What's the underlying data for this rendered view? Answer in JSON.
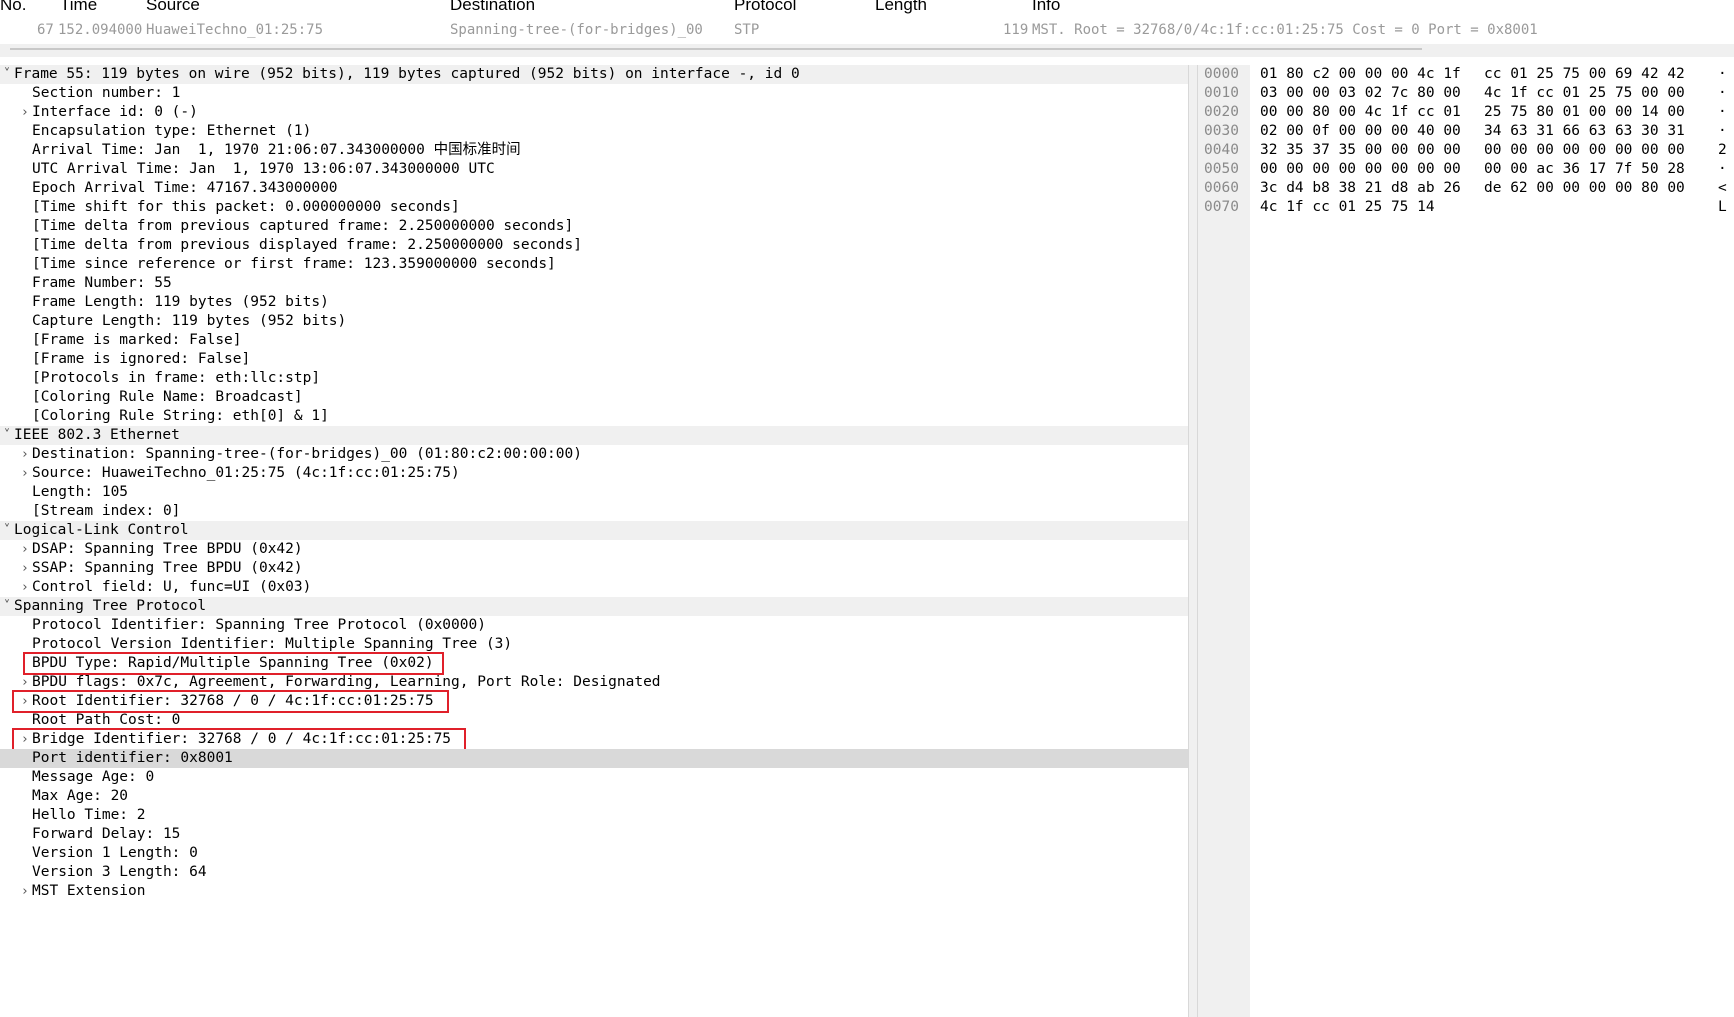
{
  "packet_list": {
    "columns": [
      "No.",
      "Time",
      "Source",
      "Destination",
      "Protocol",
      "Length",
      "Info"
    ],
    "row": {
      "no": "67",
      "time": "152.094000",
      "source": "HuaweiTechno_01:25:75",
      "destination": "Spanning-tree-(for-bridges)_00",
      "protocol": "STP",
      "length": "119",
      "info": "MST. Root = 32768/0/4c:1f:cc:01:25:75  Cost = 0  Port = 0x8001"
    }
  },
  "details": [
    {
      "text": "Frame 55: 119 bytes on wire (952 bits), 119 bytes captured (952 bits) on interface -, id 0",
      "indent": 0,
      "expander": "expanded",
      "section": true
    },
    {
      "text": "Section number: 1",
      "indent": 1,
      "expander": "none"
    },
    {
      "text": "Interface id: 0 (-)",
      "indent": 1,
      "expander": "collapsed"
    },
    {
      "text": "Encapsulation type: Ethernet (1)",
      "indent": 1,
      "expander": "none"
    },
    {
      "text": "Arrival Time: Jan  1, 1970 21:06:07.343000000 中国标准时间",
      "indent": 1,
      "expander": "none"
    },
    {
      "text": "UTC Arrival Time: Jan  1, 1970 13:06:07.343000000 UTC",
      "indent": 1,
      "expander": "none"
    },
    {
      "text": "Epoch Arrival Time: 47167.343000000",
      "indent": 1,
      "expander": "none"
    },
    {
      "text": "[Time shift for this packet: 0.000000000 seconds]",
      "indent": 1,
      "expander": "none"
    },
    {
      "text": "[Time delta from previous captured frame: 2.250000000 seconds]",
      "indent": 1,
      "expander": "none"
    },
    {
      "text": "[Time delta from previous displayed frame: 2.250000000 seconds]",
      "indent": 1,
      "expander": "none"
    },
    {
      "text": "[Time since reference or first frame: 123.359000000 seconds]",
      "indent": 1,
      "expander": "none"
    },
    {
      "text": "Frame Number: 55",
      "indent": 1,
      "expander": "none"
    },
    {
      "text": "Frame Length: 119 bytes (952 bits)",
      "indent": 1,
      "expander": "none"
    },
    {
      "text": "Capture Length: 119 bytes (952 bits)",
      "indent": 1,
      "expander": "none"
    },
    {
      "text": "[Frame is marked: False]",
      "indent": 1,
      "expander": "none"
    },
    {
      "text": "[Frame is ignored: False]",
      "indent": 1,
      "expander": "none"
    },
    {
      "text": "[Protocols in frame: eth:llc:stp]",
      "indent": 1,
      "expander": "none"
    },
    {
      "text": "[Coloring Rule Name: Broadcast]",
      "indent": 1,
      "expander": "none"
    },
    {
      "text": "[Coloring Rule String: eth[0] & 1]",
      "indent": 1,
      "expander": "none"
    },
    {
      "text": "IEEE 802.3 Ethernet",
      "indent": 0,
      "expander": "expanded",
      "section": true
    },
    {
      "text": "Destination: Spanning-tree-(for-bridges)_00 (01:80:c2:00:00:00)",
      "indent": 1,
      "expander": "collapsed"
    },
    {
      "text": "Source: HuaweiTechno_01:25:75 (4c:1f:cc:01:25:75)",
      "indent": 1,
      "expander": "collapsed"
    },
    {
      "text": "Length: 105",
      "indent": 1,
      "expander": "none"
    },
    {
      "text": "[Stream index: 0]",
      "indent": 1,
      "expander": "none"
    },
    {
      "text": "Logical-Link Control",
      "indent": 0,
      "expander": "expanded",
      "section": true
    },
    {
      "text": "DSAP: Spanning Tree BPDU (0x42)",
      "indent": 1,
      "expander": "collapsed"
    },
    {
      "text": "SSAP: Spanning Tree BPDU (0x42)",
      "indent": 1,
      "expander": "collapsed"
    },
    {
      "text": "Control field: U, func=UI (0x03)",
      "indent": 1,
      "expander": "collapsed"
    },
    {
      "text": "Spanning Tree Protocol",
      "indent": 0,
      "expander": "expanded",
      "section": true
    },
    {
      "text": "Protocol Identifier: Spanning Tree Protocol (0x0000)",
      "indent": 1,
      "expander": "none"
    },
    {
      "text": "Protocol Version Identifier: Multiple Spanning Tree (3)",
      "indent": 1,
      "expander": "none"
    },
    {
      "text": "BPDU Type: Rapid/Multiple Spanning Tree (0x02)",
      "indent": 1,
      "expander": "none",
      "boxed": true
    },
    {
      "text": "BPDU flags: 0x7c, Agreement, Forwarding, Learning, Port Role: Designated",
      "indent": 1,
      "expander": "collapsed"
    },
    {
      "text": "Root Identifier: 32768 / 0 / 4c:1f:cc:01:25:75",
      "indent": 1,
      "expander": "collapsed",
      "boxed": true
    },
    {
      "text": "Root Path Cost: 0",
      "indent": 1,
      "expander": "none"
    },
    {
      "text": "Bridge Identifier: 32768 / 0 / 4c:1f:cc:01:25:75",
      "indent": 1,
      "expander": "collapsed",
      "boxed": true
    },
    {
      "text": "Port identifier: 0x8001",
      "indent": 1,
      "expander": "none",
      "selected": true
    },
    {
      "text": "Message Age: 0",
      "indent": 1,
      "expander": "none"
    },
    {
      "text": "Max Age: 20",
      "indent": 1,
      "expander": "none"
    },
    {
      "text": "Hello Time: 2",
      "indent": 1,
      "expander": "none"
    },
    {
      "text": "Forward Delay: 15",
      "indent": 1,
      "expander": "none"
    },
    {
      "text": "Version 1 Length: 0",
      "indent": 1,
      "expander": "none"
    },
    {
      "text": "Version 3 Length: 64",
      "indent": 1,
      "expander": "none"
    },
    {
      "text": "MST Extension",
      "indent": 1,
      "expander": "collapsed"
    }
  ],
  "bytes": [
    {
      "offset": "0000",
      "hex1": "01 80 c2 00 00 00 4c 1f",
      "hex2": "cc 01 25 75 00 69 42 42",
      "ascii": "·"
    },
    {
      "offset": "0010",
      "hex1": "03 00 00 03 02 7c 80 00",
      "hex2": "4c 1f cc 01 25 75 00 00",
      "ascii": "·"
    },
    {
      "offset": "0020",
      "hex1": "00 00 80 00 4c 1f cc 01",
      "hex2": "25 75 80 01 00 00 14 00",
      "ascii": "·"
    },
    {
      "offset": "0030",
      "hex1": "02 00 0f 00 00 00 40 00",
      "hex2": "34 63 31 66 63 63 30 31",
      "ascii": "·"
    },
    {
      "offset": "0040",
      "hex1": "32 35 37 35 00 00 00 00",
      "hex2": "00 00 00 00 00 00 00 00",
      "ascii": "2"
    },
    {
      "offset": "0050",
      "hex1": "00 00 00 00 00 00 00 00",
      "hex2": "00 00 ac 36 17 7f 50 28",
      "ascii": "·"
    },
    {
      "offset": "0060",
      "hex1": "3c d4 b8 38 21 d8 ab 26",
      "hex2": "de 62 00 00 00 00 80 00",
      "ascii": "<"
    },
    {
      "offset": "0070",
      "hex1": "4c 1f cc 01 25 75 14",
      "hex2": "",
      "ascii": "L"
    }
  ],
  "colors": {
    "highlight_box": "#e0202a",
    "section_bg": "#f0f0f0",
    "selected_bg": "#d9d9d9",
    "muted_text": "#9a9a9a"
  },
  "icons": {
    "expanded": "chevron-down-icon",
    "collapsed": "chevron-right-icon"
  }
}
